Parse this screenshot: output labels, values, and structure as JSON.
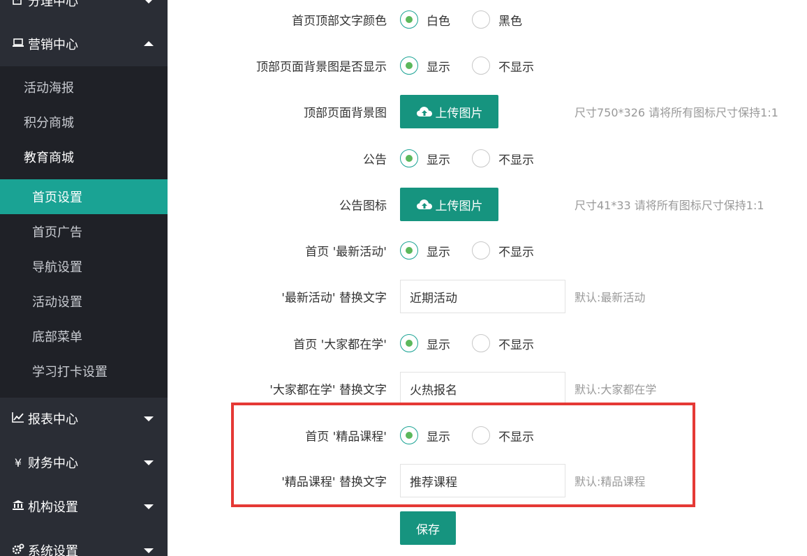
{
  "sidebar": {
    "groups": [
      {
        "label": "分理中心",
        "icon": "edit-icon"
      },
      {
        "label": "营销中心",
        "icon": "laptop-icon"
      },
      {
        "label": "报表中心",
        "icon": "line-chart-icon"
      },
      {
        "label": "财务中心",
        "icon": "yen-icon"
      },
      {
        "label": "机构设置",
        "icon": "bank-icon"
      },
      {
        "label": "系统设置",
        "icon": "cogs-icon"
      }
    ],
    "marketing_items": [
      "活动海报",
      "积分商城",
      "教育商城"
    ],
    "education_items": [
      "首页设置",
      "首页广告",
      "导航设置",
      "活动设置",
      "底部菜单",
      "学习打卡设置"
    ]
  },
  "form": {
    "rows": [
      {
        "label": "首页顶部文字颜色",
        "type": "radio",
        "options": [
          "白色",
          "黑色"
        ],
        "selected": 0
      },
      {
        "label": "顶部页面背景图是否显示",
        "type": "radio",
        "options": [
          "显示",
          "不显示"
        ],
        "selected": 0
      },
      {
        "label": "顶部页面背景图",
        "type": "upload",
        "button": "上传图片",
        "hint": "尺寸750*326 请将所有图标尺寸保持1:1"
      },
      {
        "label": "公告",
        "type": "radio",
        "options": [
          "显示",
          "不显示"
        ],
        "selected": 0
      },
      {
        "label": "公告图标",
        "type": "upload",
        "button": "上传图片",
        "hint": "尺寸41*33 请将所有图标尺寸保持1:1"
      },
      {
        "label": "首页 '最新活动'",
        "type": "radio",
        "options": [
          "显示",
          "不显示"
        ],
        "selected": 0
      },
      {
        "label": "'最新活动' 替换文字",
        "type": "text",
        "value": "近期活动",
        "hint": "默认:最新活动"
      },
      {
        "label": "首页 '大家都在学'",
        "type": "radio",
        "options": [
          "显示",
          "不显示"
        ],
        "selected": 0
      },
      {
        "label": "'大家都在学' 替换文字",
        "type": "text",
        "value": "火热报名",
        "hint": "默认:大家都在学"
      },
      {
        "label": "首页 '精品课程'",
        "type": "radio",
        "options": [
          "显示",
          "不显示"
        ],
        "selected": 0
      },
      {
        "label": "'精品课程' 替换文字",
        "type": "text",
        "value": "推荐课程",
        "hint": "默认:精品课程"
      }
    ],
    "save_label": "保存"
  },
  "colors": {
    "sidebar_bg": "#2a2d35",
    "submenu_bg": "#1f2127",
    "active_item": "#1aa394",
    "primary_button": "#16947f",
    "highlight_border": "#e53935"
  }
}
